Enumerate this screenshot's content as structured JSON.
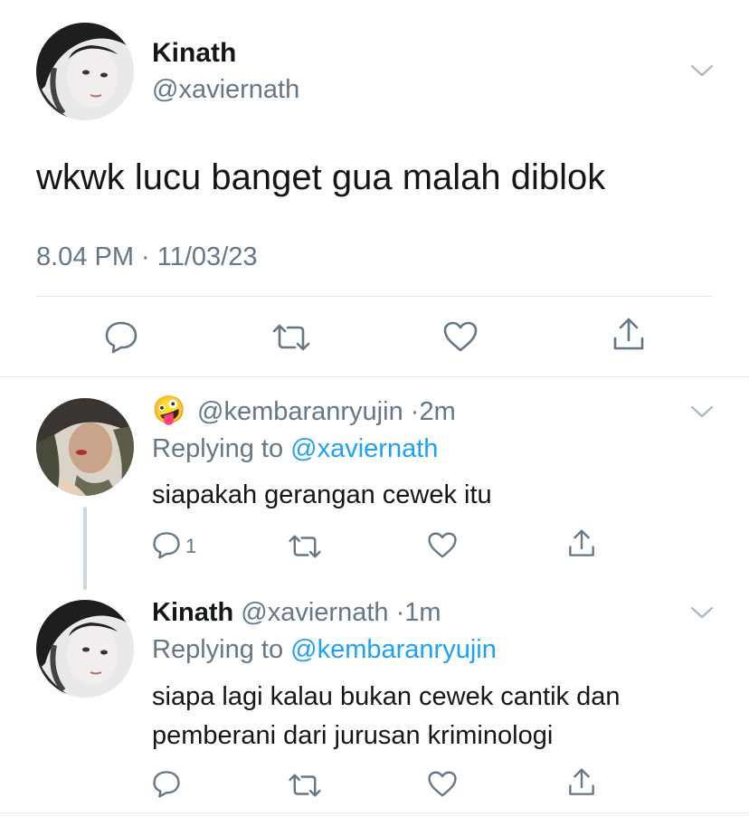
{
  "main_tweet": {
    "display_name": "Kinath",
    "handle": "@xaviernath",
    "text": "wkwk lucu banget gua malah diblok",
    "timestamp": "8.04 PM · 11/03/23"
  },
  "replies": [
    {
      "emoji": "🤪",
      "handle": "@kembaranryujin",
      "separator": "·",
      "time": "2m",
      "replying_prefix": "Replying to",
      "replying_to": "@xaviernath",
      "text": "siapakah gerangan cewek itu",
      "reply_count": "1"
    },
    {
      "display_name": "Kinath",
      "handle": "@xaviernath",
      "separator": "·",
      "time": "1m",
      "replying_prefix": "Replying to",
      "replying_to": "@kembaranryujin",
      "text_line1": "siapa lagi kalau bukan cewek cantik dan",
      "text_line2": "pemberani dari jurusan kriminologi"
    }
  ],
  "icons": {
    "reply": "speech-bubble-icon",
    "retweet": "retweet-icon",
    "like": "heart-icon",
    "share": "share-icon",
    "more": "chevron-down-icon"
  },
  "colors": {
    "text": "#14171a",
    "secondary": "#657786",
    "link": "#1da1f2",
    "divider": "#e1e8ed"
  }
}
